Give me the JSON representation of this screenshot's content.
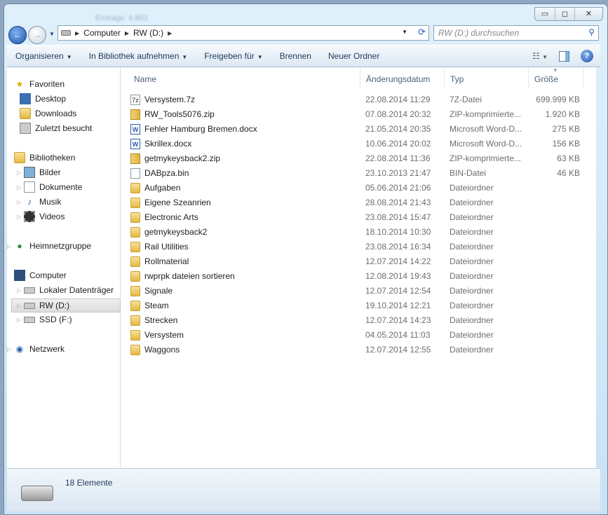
{
  "window": {
    "blurred_title": "Eintrage: 4.863",
    "buttons": {
      "minimize": "▭",
      "maximize": "◻",
      "close": "✕"
    }
  },
  "address": {
    "crumbs": [
      "Computer",
      "RW (D:)"
    ],
    "search_placeholder": "RW (D:) durchsuchen"
  },
  "toolbar": {
    "organize": "Organisieren",
    "library": "In Bibliothek aufnehmen",
    "share": "Freigeben für",
    "burn": "Brennen",
    "new_folder": "Neuer Ordner"
  },
  "nav": {
    "favorites": "Favoriten",
    "desktop": "Desktop",
    "downloads": "Downloads",
    "recent": "Zuletzt besucht",
    "libraries": "Bibliotheken",
    "pictures": "Bilder",
    "documents": "Dokumente",
    "music": "Musik",
    "videos": "Videos",
    "homegroup": "Heimnetzgruppe",
    "computer": "Computer",
    "local": "Lokaler Datenträger",
    "rw": "RW (D:)",
    "ssd": "SSD (F:)",
    "network": "Netzwerk"
  },
  "columns": {
    "name": "Name",
    "date": "Änderungsdatum",
    "type": "Typ",
    "size": "Größe"
  },
  "files": [
    {
      "name": "Versystem.7z",
      "date": "22.08.2014 11:29",
      "type": "7Z-Datei",
      "size": "699.999 KB",
      "icon": "7z"
    },
    {
      "name": "RW_Tools5076.zip",
      "date": "07.08.2014 20:32",
      "type": "ZIP-komprimierte...",
      "size": "1.920 KB",
      "icon": "zip"
    },
    {
      "name": "Fehler Hamburg Bremen.docx",
      "date": "21.05.2014 20:35",
      "type": "Microsoft Word-D...",
      "size": "275 KB",
      "icon": "word"
    },
    {
      "name": "Skrillex.docx",
      "date": "10.06.2014 20:02",
      "type": "Microsoft Word-D...",
      "size": "156 KB",
      "icon": "word"
    },
    {
      "name": "getmykeysback2.zip",
      "date": "22.08.2014 11:36",
      "type": "ZIP-komprimierte...",
      "size": "63 KB",
      "icon": "zip"
    },
    {
      "name": "DABpza.bin",
      "date": "23.10.2013 21:47",
      "type": "BIN-Datei",
      "size": "46 KB",
      "icon": "doc"
    },
    {
      "name": "Aufgaben",
      "date": "05.06.2014 21:06",
      "type": "Dateiordner",
      "size": "",
      "icon": "folder"
    },
    {
      "name": "Eigene Szeanrien",
      "date": "28.08.2014 21:43",
      "type": "Dateiordner",
      "size": "",
      "icon": "folder"
    },
    {
      "name": "Electronic Arts",
      "date": "23.08.2014 15:47",
      "type": "Dateiordner",
      "size": "",
      "icon": "folder"
    },
    {
      "name": "getmykeysback2",
      "date": "18.10.2014 10:30",
      "type": "Dateiordner",
      "size": "",
      "icon": "folder"
    },
    {
      "name": "Rail Utilities",
      "date": "23.08.2014 16:34",
      "type": "Dateiordner",
      "size": "",
      "icon": "folder"
    },
    {
      "name": "Rollmaterial",
      "date": "12.07.2014 14:22",
      "type": "Dateiordner",
      "size": "",
      "icon": "folder"
    },
    {
      "name": "rwprpk dateien sortieren",
      "date": "12.08.2014 19:43",
      "type": "Dateiordner",
      "size": "",
      "icon": "folder"
    },
    {
      "name": "Signale",
      "date": "12.07.2014 12:54",
      "type": "Dateiordner",
      "size": "",
      "icon": "folder"
    },
    {
      "name": "Steam",
      "date": "19.10.2014 12:21",
      "type": "Dateiordner",
      "size": "",
      "icon": "folder"
    },
    {
      "name": "Strecken",
      "date": "12.07.2014 14:23",
      "type": "Dateiordner",
      "size": "",
      "icon": "folder"
    },
    {
      "name": "Versystem",
      "date": "04.05.2014 11:03",
      "type": "Dateiordner",
      "size": "",
      "icon": "folder"
    },
    {
      "name": "Waggons",
      "date": "12.07.2014 12:55",
      "type": "Dateiordner",
      "size": "",
      "icon": "folder"
    }
  ],
  "status": {
    "count": "18 Elemente"
  }
}
